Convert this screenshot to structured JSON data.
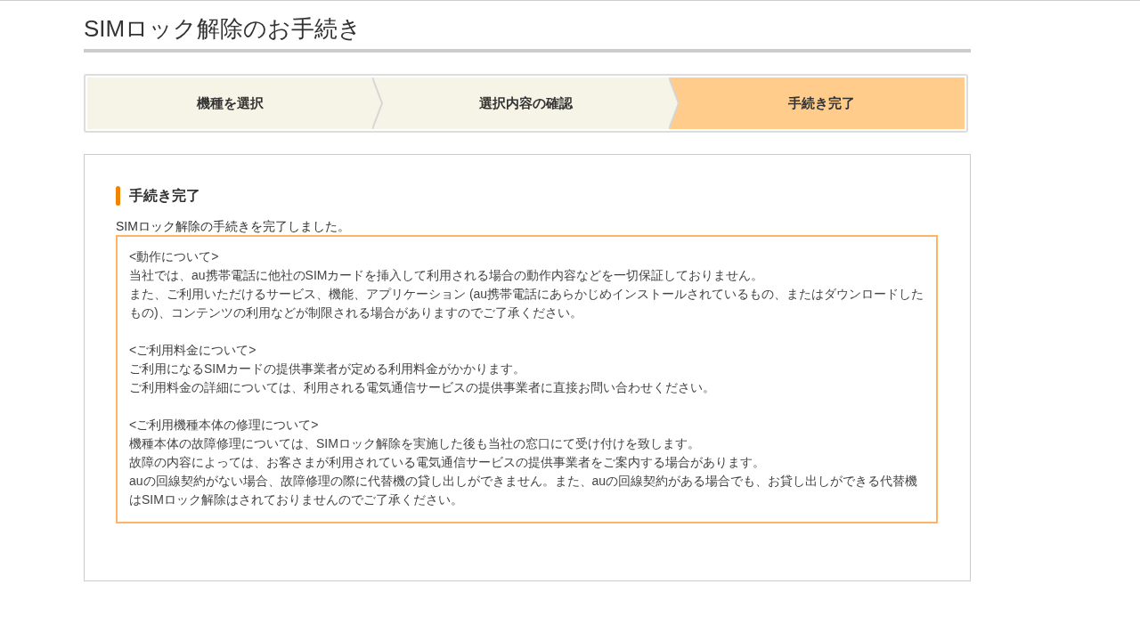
{
  "page_title": "SIMロック解除のお手続き",
  "steps": [
    {
      "label": "機種を選択",
      "selected": false
    },
    {
      "label": "選択内容の確認",
      "selected": false
    },
    {
      "label": "手続き完了",
      "selected": true
    }
  ],
  "panel": {
    "heading": "手続き完了",
    "message": "SIMロック解除の手続きを完了しました。",
    "notice": [
      {
        "heading": "<動作について>",
        "lines": [
          "当社では、au携帯電話に他社のSIMカードを挿入して利用される場合の動作内容などを一切保証しておりません。",
          "また、ご利用いただけるサービス、機能、アプリケーション (au携帯電話にあらかじめインストールされているもの、またはダウンロードしたもの)、コンテンツの利用などが制限される場合がありますのでご了承ください。"
        ]
      },
      {
        "heading": "<ご利用料金について>",
        "lines": [
          "ご利用になるSIMカードの提供事業者が定める利用料金がかかります。",
          "ご利用料金の詳細については、利用される電気通信サービスの提供事業者に直接お問い合わせください。"
        ]
      },
      {
        "heading": "<ご利用機種本体の修理について>",
        "lines": [
          "機種本体の故障修理については、SIMロック解除を実施した後も当社の窓口にて受け付けを致します。",
          "故障の内容によっては、お客さまが利用されている電気通信サービスの提供事業者をご案内する場合があります。",
          "auの回線契約がない場合、故障修理の際に代替機の貸し出しができません。また、auの回線契約がある場合でも、お貸し出しができる代替機はSIMロック解除はされておりませんのでご了承ください。"
        ]
      }
    ]
  }
}
